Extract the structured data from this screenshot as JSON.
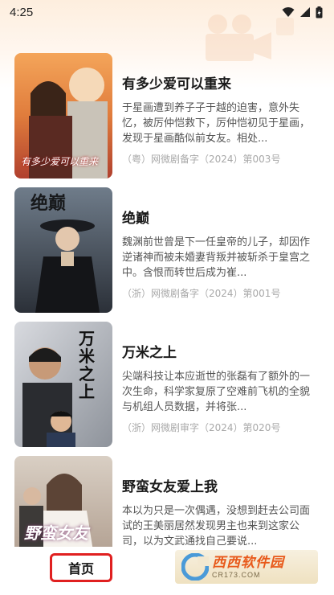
{
  "status_bar": {
    "time": "4:25",
    "icons": [
      "wifi-icon",
      "signal-icon",
      "battery-icon"
    ]
  },
  "dramas": [
    {
      "title": "有多少爱可以重来",
      "description": "于星画遭到养子子于越的迫害，意外失忆，被厉仲恺救下，厉仲恺初见于星画，发现于星画酷似前女友。相处...",
      "license": "（粤）网微剧备字（2024）第003号",
      "poster_text": "有多少爱可以重来"
    },
    {
      "title": "绝巅",
      "description": "魏渊前世曾是下一任皇帝的儿子，却因作逆诸神而被未婚妻背叛并被斩杀于皇宫之中。含恨而转世后成为崔...",
      "license": "（浙）网微剧备字（2024）第001号",
      "poster_text": "绝巅"
    },
    {
      "title": "万米之上",
      "description": "尖端科技让本应逝世的张磊有了额外的一次生命，科学家复原了空难前飞机的全貌与机组人员数据，并将张...",
      "license": "（浙）网微剧审字（2024）第020号",
      "poster_text": "万米之上"
    },
    {
      "title": "野蛮女友爱上我",
      "description": "本以为只是一次偶遇，没想到赶去公司面试的王美丽居然发现男主也来到这家公司，以为文武通找自己要说...",
      "license": "",
      "poster_text": "野蛮女友"
    }
  ],
  "bottom_nav": {
    "home_label": "首页"
  },
  "watermark": {
    "brand": "西西软件园",
    "site": "CR173.COM"
  },
  "colors": {
    "accent_red": "#e02020",
    "header_tint": "#fdeede"
  }
}
